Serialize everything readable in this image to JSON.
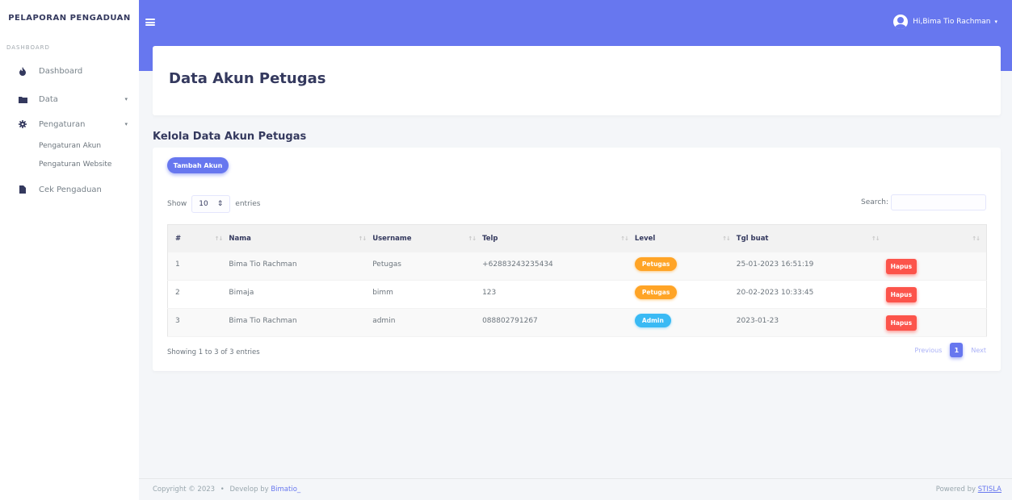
{
  "sidebar": {
    "brand": "PELAPORAN PENGADUAN",
    "menu_header": "DASHBOARD",
    "items": [
      {
        "label": "Dashboard"
      },
      {
        "label": "Data"
      },
      {
        "label": "Pengaturan"
      },
      {
        "label": "Cek Pengaduan"
      }
    ],
    "subitems": [
      {
        "label": "Pengaturan Akun"
      },
      {
        "label": "Pengaturan Website"
      }
    ]
  },
  "topbar": {
    "greeting": "Hi,Bima Tio Rachman"
  },
  "header": {
    "title": "Data Akun Petugas"
  },
  "section": {
    "title": "Kelola Data Akun Petugas",
    "add_button": "Tambah Akun"
  },
  "table_controls": {
    "show_label": "Show",
    "entries_value": "10",
    "entries_label": "entries",
    "search_label": "Search:"
  },
  "table": {
    "headers": [
      "#",
      "Nama",
      "Username",
      "Telp",
      "Level",
      "Tgl buat",
      ""
    ],
    "rows": [
      {
        "no": "1",
        "nama": "Bima Tio Rachman",
        "username": "Petugas",
        "telp": "+62883243235434",
        "level": "Petugas",
        "tgl": "25-01-2023 16:51:19",
        "action": "Hapus"
      },
      {
        "no": "2",
        "nama": "Bimaja",
        "username": "bimm",
        "telp": "123",
        "level": "Petugas",
        "tgl": "20-02-2023 10:33:45",
        "action": "Hapus"
      },
      {
        "no": "3",
        "nama": "Bima Tio Rachman",
        "username": "admin",
        "telp": "088802791267",
        "level": "Admin",
        "tgl": "2023-01-23",
        "action": "Hapus"
      }
    ],
    "info": "Showing 1 to 3 of 3 entries",
    "prev": "Previous",
    "page": "1",
    "next": "Next"
  },
  "footer": {
    "copyright": "Copyright © 2023",
    "bullet": "•",
    "develop": "Develop by",
    "developer": "Bimatio_",
    "powered": "Powered by",
    "powered_link": "STISLA"
  },
  "colors": {
    "primary": "#6777ef",
    "warning": "#ffa426",
    "info": "#3abaf4",
    "danger": "#fc544b"
  }
}
